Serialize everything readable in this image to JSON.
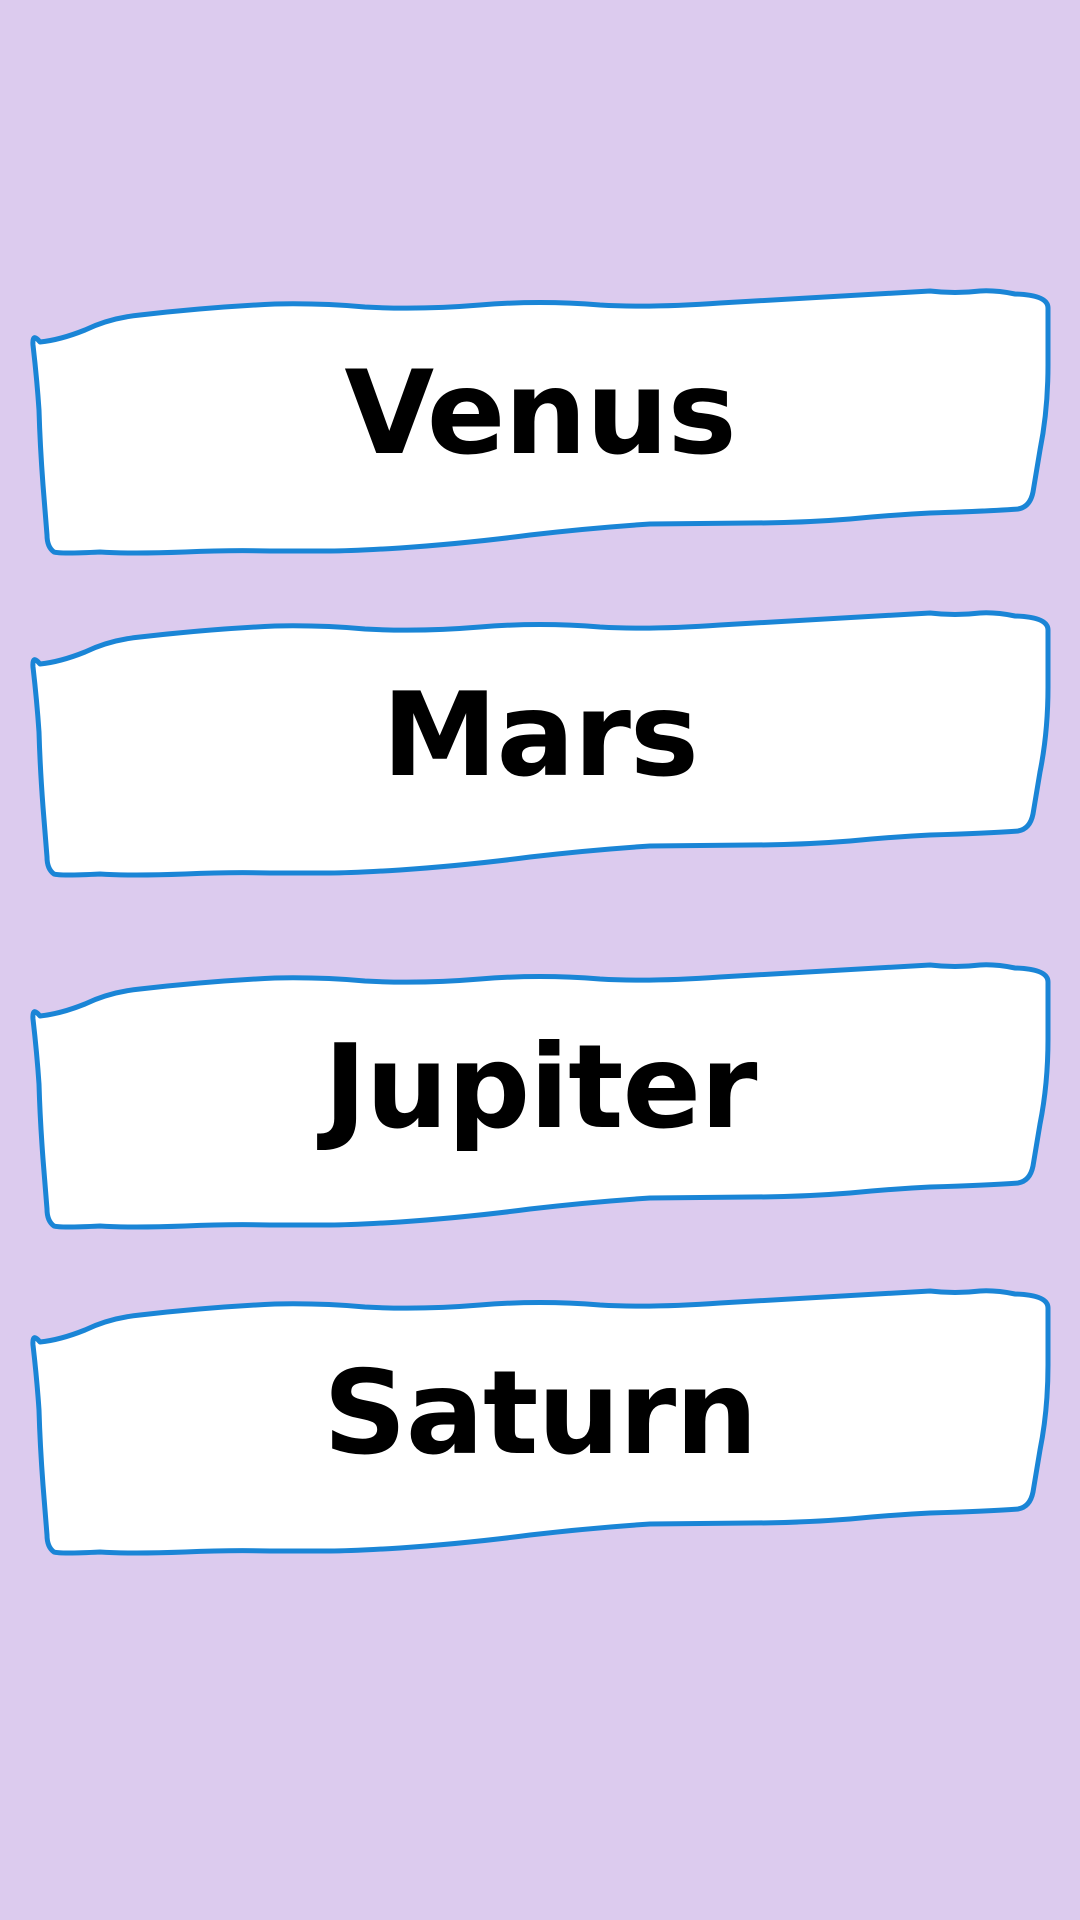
{
  "colors": {
    "background": "#dccbee",
    "card_fill": "#ffffff",
    "card_outline": "#1a85d6",
    "text": "#000000"
  },
  "options": [
    {
      "label": "Venus"
    },
    {
      "label": "Mars"
    },
    {
      "label": "Jupiter"
    },
    {
      "label": "Saturn"
    }
  ]
}
